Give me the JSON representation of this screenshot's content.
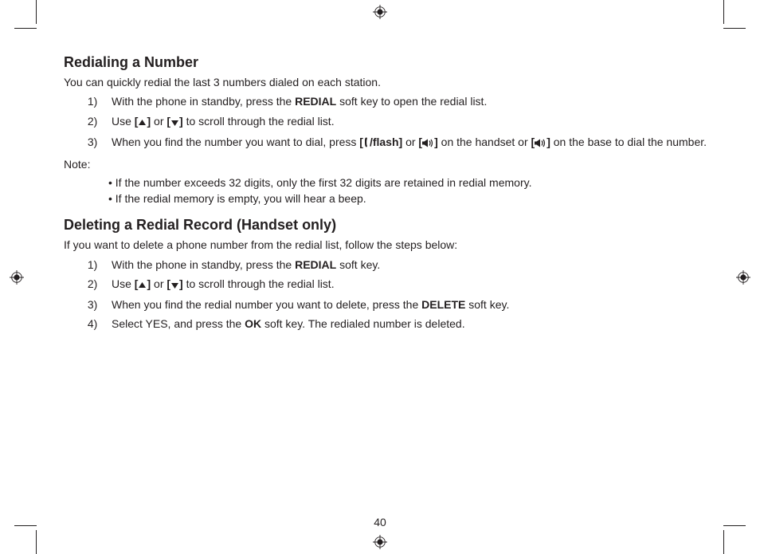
{
  "page_number": "40",
  "section1": {
    "heading": "Redialing a Number",
    "intro": "You can quickly redial the last 3 numbers dialed on each station.",
    "steps": [
      {
        "pre": "With the phone in standby, press the ",
        "bold": "REDIAL",
        "post": " soft key to open the redial list."
      },
      {
        "full_with_icons": "Use [▲] or [▼] to scroll through the redial list.",
        "pre": "Use ",
        "b1": "[",
        "icon1": "up",
        "b2": "]",
        "mid": " or ",
        "b3": "[",
        "icon2": "down",
        "b4": "]",
        "post": " to scroll through the redial list."
      },
      {
        "pre": "When you find the number you want to dial, press ",
        "b1": "[",
        "icon1": "phone",
        "flash": "/flash]",
        "mid1": " or ",
        "b2": "[",
        "icon2": "speaker",
        "b3": "]",
        "mid2": " on the handset or ",
        "b4": "[",
        "icon3": "speaker",
        "b5": "]",
        "post": " on the base to dial the number."
      }
    ],
    "note_label": "Note:",
    "notes": [
      "If the number exceeds 32 digits, only the first 32 digits are retained in redial memory.",
      "If the redial memory is empty, you will hear a beep."
    ]
  },
  "section2": {
    "heading": "Deleting a Redial Record (Handset only)",
    "intro": "If you want to delete a phone number from the redial list, follow the steps below:",
    "steps": [
      {
        "pre": "With the phone in standby, press the ",
        "bold": "REDIAL",
        "post": " soft key."
      },
      {
        "pre": "Use ",
        "b1": "[",
        "icon1": "up",
        "b2": "]",
        "mid": " or ",
        "b3": "[",
        "icon2": "down",
        "b4": "]",
        "post": " to scroll through the redial list."
      },
      {
        "pre": "When you find the redial number you want to delete, press the ",
        "bold": "DELETE",
        "post": " soft key."
      },
      {
        "pre": "Select YES, and press the ",
        "bold": "OK",
        "post": " soft key. The redialed number is deleted."
      }
    ]
  }
}
